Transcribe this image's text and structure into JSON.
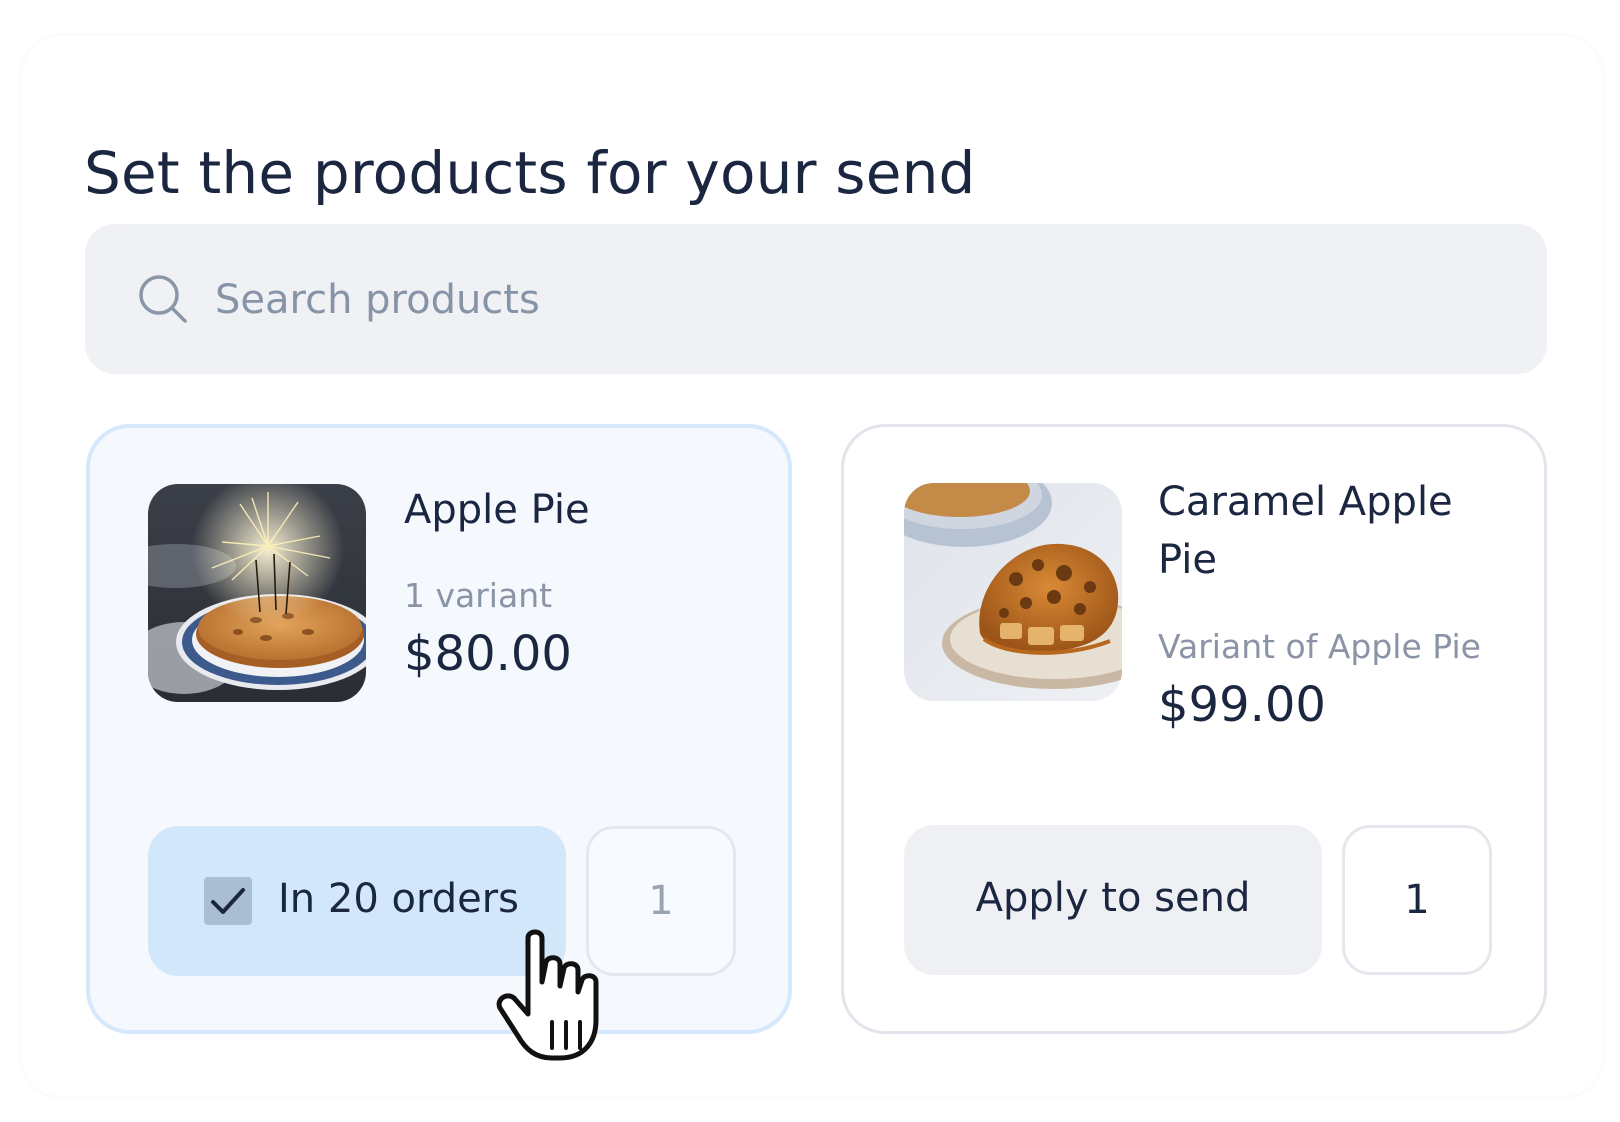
{
  "page": {
    "title": "Set the products for your send"
  },
  "search": {
    "placeholder": "Search products",
    "value": "",
    "icon": "search-icon"
  },
  "products": [
    {
      "name": "Apple Pie",
      "subtitle": "1 variant",
      "price": "$80.00",
      "image": "apple-pie-sparklers-photo",
      "selected": true,
      "action_label": "In 20 orders",
      "checked": true,
      "quantity": "1"
    },
    {
      "name": "Caramel Apple Pie",
      "subtitle": "Variant of Apple Pie",
      "price": "$99.00",
      "image": "caramel-apple-pie-slice-photo",
      "selected": false,
      "action_label": "Apply to send",
      "checked": false,
      "quantity": "1"
    }
  ],
  "colors": {
    "text": "#1b2640",
    "muted": "#8a94a6",
    "search_bg": "#f0f1f5",
    "selected_card_bg": "#f5f9fe",
    "selected_border": "#d6e8fb",
    "selected_button_bg": "#d3e7fb",
    "button_bg": "#eff0f4",
    "checkbox_bg": "#a9bdd3"
  }
}
